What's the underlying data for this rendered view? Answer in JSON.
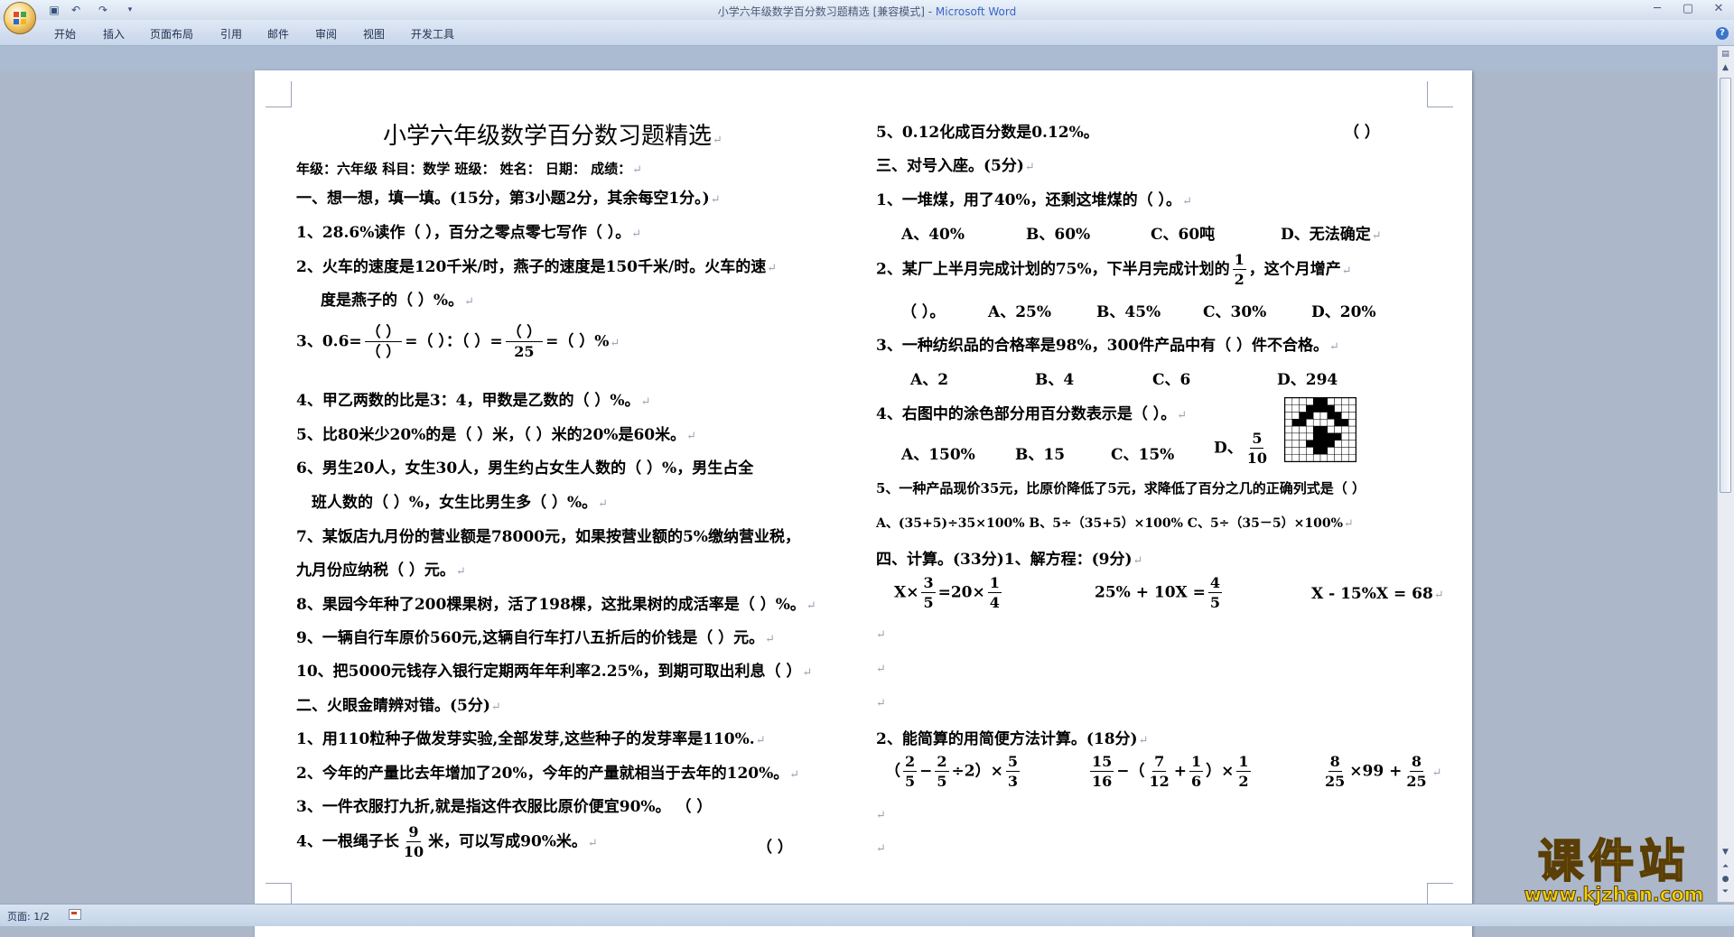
{
  "window": {
    "title": "小学六年级数学百分数习题精选 [兼容模式] - ",
    "app_name": "Microsoft Word",
    "minimize_glyph": "─",
    "maximize_glyph": "▢",
    "close_glyph": "✕"
  },
  "qat": {
    "save_icon": "save-icon",
    "undo_icon": "undo-icon",
    "redo_icon": "redo-icon",
    "customize_icon": "dropdown-icon"
  },
  "ribbon": {
    "tabs": [
      "开始",
      "插入",
      "页面布局",
      "引用",
      "邮件",
      "审阅",
      "视图",
      "开发工具"
    ]
  },
  "status": {
    "page": "页面: 1/2"
  },
  "watermark": {
    "cn": "课件站",
    "url": "www.kjzhan.com"
  },
  "colors": {
    "accent": "#3a66c6",
    "canvas": "#acb8c9",
    "watermark": "#f2d20a"
  },
  "doc": {
    "title": "小学六年级数学百分数习题精选",
    "info": "年级：六年级    科目：数学    班级：       姓名：        日期：        成绩：",
    "s1": "一、想一想，填一填。(15分，第3小题2分，其余每空1分。)",
    "q1_1": "1、28.6%读作（                ），百分之零点零七写作（    ）。",
    "q1_2a": "2、火车的速度是120千米/时，燕子的速度是150千米/时。火车的速",
    "q1_2b": "度是燕子的（    ）%。",
    "q1_3_pre": "3、0.6=",
    "q1_3_f1n": "（  ）",
    "q1_3_f1d": "（  ）",
    "q1_3_mid": "=（    ）：（    ）=",
    "q1_3_f2n": "（  ）",
    "q1_3_f2d": "25",
    "q1_3_post": "=（      ）%",
    "q1_4": "4、甲乙两数的比是3：4，甲数是乙数的（       ）%。",
    "q1_5": "5、比80米少20%的是（     ）米，（     ）米的20%是60米。",
    "q1_6a": "6、男生20人，女生30人，男生约占女生人数的（       ）%，男生占全",
    "q1_6b": "班人数的（     ）%，女生比男生多（       ）%。",
    "q1_7a": "7、某饭店九月份的营业额是78000元，如果按营业额的5%缴纳营业税，",
    "q1_7b": "九月份应纳税（      ）元。",
    "q1_8": "8、果园今年种了200棵果树，活了198棵，这批果树的成活率是（ ）%。",
    "q1_9": "9、一辆自行车原价560元,这辆自行车打八五折后的价钱是（   ）元。",
    "q1_10": "10、把5000元钱存入银行定期两年年利率2.25%，到期可取出利息（   ）",
    "s2": "二、火眼金睛辨对错。(5分)",
    "q2_1": "1、用110粒种子做发芽实验,全部发芽,这些种子的发芽率是110%.",
    "q2_2": "2、今年的产量比去年增加了20%，今年的产量就相当于去年的120%。",
    "q2_3": "3、一件衣服打九折,就是指这件衣服比原价便宜90%。     （      ）",
    "q2_4_pre": "4、一根绳子长",
    "q2_4_fn": "9",
    "q2_4_fd": "10",
    "q2_4_post": "米，可以写成90%米。",
    "q2_4_paren": "（      ）",
    "q2_5": "5、0.12化成百分数是0.12%。",
    "q2_5_paren": "（      ）",
    "s3": "三、对号入座。(5分)",
    "q3_1": "1、一堆煤，用了40%，还剩这堆煤的（       ）。",
    "q3_1o": [
      "A、40%",
      "B、60%",
      "C、60吨",
      "D、无法确定"
    ],
    "q3_2_pre": "2、某厂上半月完成计划的75%，下半月完成计划的",
    "q3_2_fn": "1",
    "q3_2_fd": "2",
    "q3_2_post": "，这个月增产",
    "q3_2o": [
      "（       ）。",
      "A、25%",
      "B、45%",
      "C、30%",
      "D、20%"
    ],
    "q3_3": "3、一种纺织品的合格率是98%，300件产品中有（   ）件不合格。",
    "q3_3o": [
      "A、2",
      "B、4",
      "C、6",
      "D、294"
    ],
    "q3_4": "4、右图中的涂色部分用百分数表示是（       ）。",
    "q3_4o": [
      "A、150%",
      "B、15",
      "C、15%",
      "D、"
    ],
    "q3_4d_n": "5",
    "q3_4d_d": "10",
    "q3_5": "5、一种产品现价35元，比原价降低了5元，求降低了百分之几的正确列式是（  ）",
    "q3_5o": "A、(35+5)÷35×100%    B、5÷（35+5）×100%  C、5÷（35－5）×100%",
    "s4": "四、计算。(33分)1、解方程：(9分)",
    "eq1_a": "X×",
    "eq1_f1n": "3",
    "eq1_f1d": "5",
    "eq1_b": "=20×",
    "eq1_f2n": "1",
    "eq1_f2d": "4",
    "eq2_a": "25% + 10X =",
    "eq2_fn": "4",
    "eq2_fd": "5",
    "eq3": "X - 15%X = 68",
    "s4_2": "2、能简算的用简便方法计算。(18分)",
    "c1_open": "（",
    "c1_f1n": "2",
    "c1_f1d": "5",
    "c1_minus": "−",
    "c1_f2n": "2",
    "c1_f2d": "5",
    "c1_div": "÷2）×",
    "c1_f3n": "5",
    "c1_f3d": "3",
    "c2_f1n": "15",
    "c2_f1d": "16",
    "c2_mid": "−（",
    "c2_f2n": "7",
    "c2_f2d": "12",
    "c2_plus": "+",
    "c2_f3n": "1",
    "c2_f3d": "6",
    "c2_end": "）×",
    "c2_f4n": "1",
    "c2_f4d": "2",
    "c3_f1n": "8",
    "c3_f1d": "25",
    "c3_mid": "×99 +",
    "c3_f2n": "8",
    "c3_f2d": "25"
  }
}
